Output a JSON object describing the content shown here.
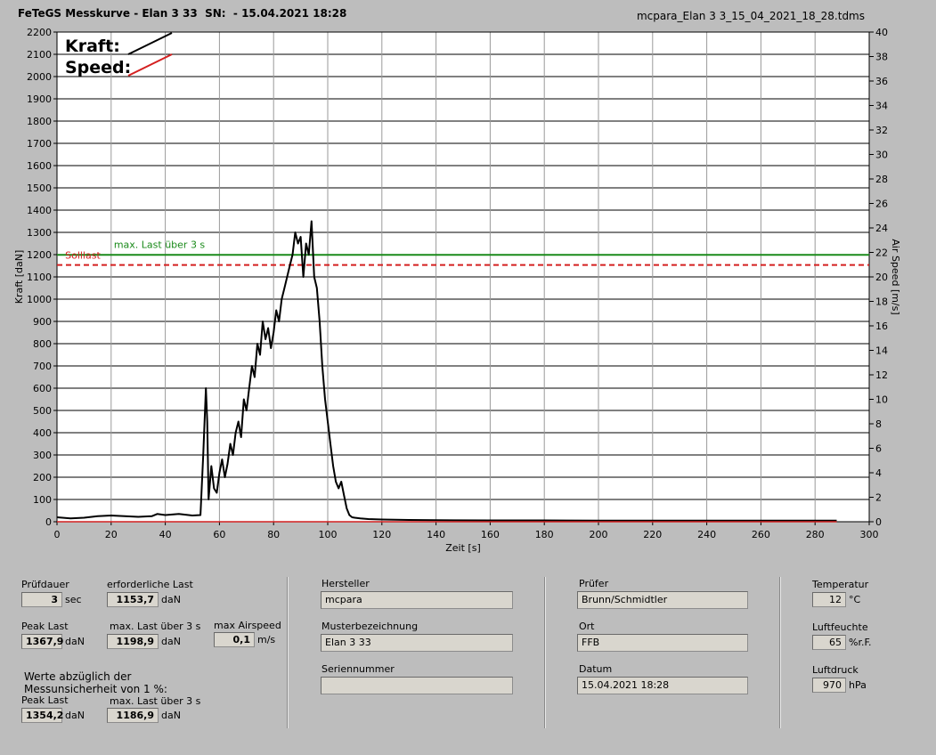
{
  "header": {
    "title": "FeTeGS Messkurve - Elan 3 33  SN:  - 15.04.2021 18:28",
    "filename": "mcpara_Elan 3 3_15_04_2021_18_28.tdms"
  },
  "chart_data": {
    "type": "line",
    "xlabel": "Zeit [s]",
    "ylabel": "Kraft [daN]",
    "y2label": "Air Speed [m/s]",
    "xlim": [
      0,
      300
    ],
    "ylim": [
      0,
      2200
    ],
    "y2lim": [
      0,
      40
    ],
    "xticks": [
      0,
      20,
      40,
      60,
      80,
      100,
      120,
      140,
      160,
      180,
      200,
      220,
      240,
      260,
      280,
      300
    ],
    "yticks": [
      0,
      100,
      200,
      300,
      400,
      500,
      600,
      700,
      800,
      900,
      1000,
      1100,
      1200,
      1300,
      1400,
      1500,
      1600,
      1700,
      1800,
      1900,
      2000,
      2100,
      2200
    ],
    "y2ticks": [
      0,
      2,
      4,
      6,
      8,
      10,
      12,
      14,
      16,
      18,
      20,
      22,
      24,
      26,
      28,
      30,
      32,
      34,
      36,
      38,
      40
    ],
    "grid": true,
    "legend": {
      "position": "top-left",
      "items": [
        {
          "label": "Kraft:",
          "color": "#000000"
        },
        {
          "label": "Speed:",
          "color": "#d42020"
        }
      ]
    },
    "reference_lines": [
      {
        "label": "max. Last über  3 s",
        "value": 1198.9,
        "color": "#1a8a1a"
      },
      {
        "label": "Solllast",
        "value": 1153.7,
        "color": "#d42020"
      }
    ],
    "series": [
      {
        "name": "Kraft:",
        "color": "#000000",
        "x": [
          0,
          5,
          10,
          15,
          20,
          25,
          30,
          35,
          37,
          40,
          45,
          50,
          53,
          54,
          55,
          55.5,
          56,
          57,
          58,
          59,
          60,
          61,
          62,
          63,
          64,
          65,
          66,
          67,
          68,
          69,
          70,
          71,
          72,
          73,
          74,
          75,
          76,
          77,
          78,
          79,
          80,
          81,
          82,
          83,
          84,
          85,
          86,
          87,
          88,
          89,
          90,
          91,
          92,
          93,
          94,
          95,
          96,
          97,
          98,
          99,
          100,
          101,
          102,
          103,
          104,
          105,
          106,
          107,
          108,
          109,
          110,
          112,
          115,
          120,
          130,
          140,
          160,
          180,
          200,
          220,
          240,
          260,
          280,
          288
        ],
        "y": [
          20,
          15,
          18,
          25,
          28,
          25,
          22,
          25,
          35,
          30,
          35,
          28,
          30,
          300,
          600,
          450,
          100,
          250,
          150,
          130,
          220,
          280,
          200,
          260,
          350,
          300,
          400,
          450,
          380,
          550,
          500,
          600,
          700,
          650,
          800,
          750,
          900,
          820,
          870,
          780,
          850,
          950,
          900,
          1000,
          1050,
          1100,
          1150,
          1200,
          1300,
          1250,
          1280,
          1100,
          1250,
          1200,
          1350,
          1100,
          1050,
          900,
          700,
          550,
          450,
          350,
          250,
          180,
          150,
          180,
          120,
          60,
          30,
          20,
          18,
          15,
          12,
          10,
          8,
          7,
          6,
          6,
          5,
          5,
          5,
          5,
          5,
          5
        ]
      },
      {
        "name": "Speed:",
        "color": "#d42020",
        "x": [
          0,
          288
        ],
        "y": [
          0,
          0
        ]
      }
    ]
  },
  "panel": {
    "pruefdauer": {
      "label": "Prüfdauer",
      "value": "3",
      "unit": "sec"
    },
    "erforderliche_last": {
      "label": "erforderliche Last",
      "value": "1153,7",
      "unit": "daN"
    },
    "peak_last": {
      "label": "Peak Last",
      "value": "1367,9",
      "unit": "daN"
    },
    "max_last": {
      "label": "max. Last über  3 s",
      "value": "1198,9",
      "unit": "daN"
    },
    "max_airspeed": {
      "label": "max Airspeed",
      "value": "0,1",
      "unit": "m/s"
    },
    "note_line1": "Werte abzüglich der",
    "note_line2": "Messunsicherheit von 1  %:",
    "peak_last_corr": {
      "label": "Peak Last",
      "value": "1354,2",
      "unit": "daN"
    },
    "max_last_corr": {
      "label": "max. Last über  3 s",
      "value": "1186,9",
      "unit": "daN"
    },
    "hersteller": {
      "label": "Hersteller",
      "value": "mcpara"
    },
    "musterbezeichnung": {
      "label": "Musterbezeichnung",
      "value": "Elan 3 33"
    },
    "seriennummer": {
      "label": "Seriennummer",
      "value": ""
    },
    "pruefer": {
      "label": "Prüfer",
      "value": "Brunn/Schmidtler"
    },
    "ort": {
      "label": "Ort",
      "value": "FFB"
    },
    "datum": {
      "label": "Datum",
      "value": "15.04.2021 18:28"
    },
    "temperatur": {
      "label": "Temperatur",
      "value": "12",
      "unit": "°C"
    },
    "luftfeuchte": {
      "label": "Luftfeuchte",
      "value": "65",
      "unit": "%r.F."
    },
    "luftdruck": {
      "label": "Luftdruck",
      "value": "970",
      "unit": "hPa"
    }
  }
}
